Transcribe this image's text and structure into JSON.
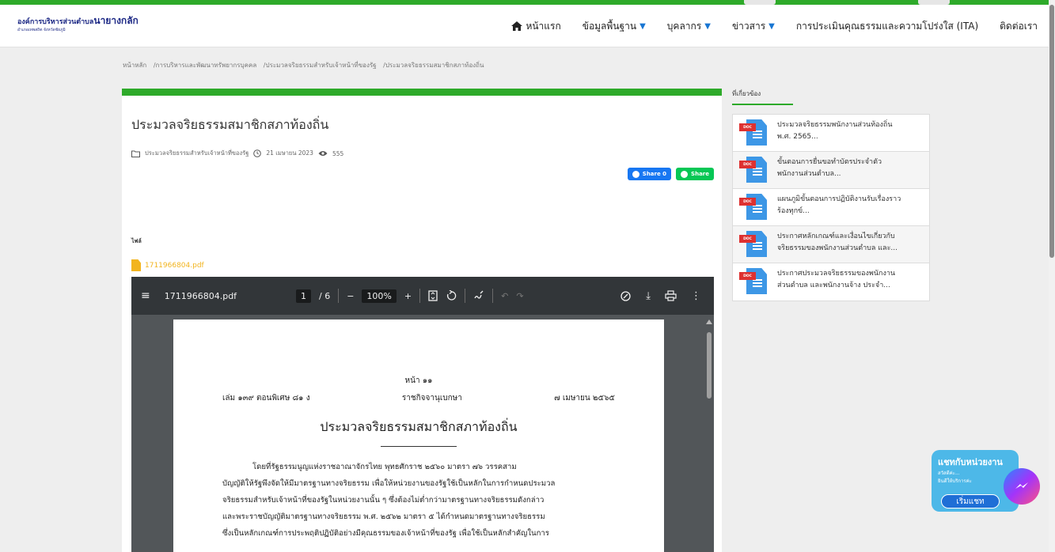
{
  "brand": {
    "line1_prefix": "องค์การบริหารส่วนตำบล",
    "line1_name": "นายางกลัก",
    "line2": "อำเภอเทพสถิต จังหวัดชัยภูมิ"
  },
  "nav": {
    "items": [
      {
        "label": "หน้าแรก",
        "icon": "home-icon"
      },
      {
        "label": "ข้อมูลพื้นฐาน",
        "caret": true
      },
      {
        "label": "บุคลากร",
        "caret": true
      },
      {
        "label": "ข่าวสาร",
        "caret": true
      },
      {
        "label": "การประเมินคุณธรรมและความโปร่งใส (ITA)"
      },
      {
        "label": "ติดต่อเรา"
      }
    ]
  },
  "breadcrumb": [
    "หน้าหลัก",
    "/การบริหารและพัฒนาทรัพยากรบุคคล",
    "/ประมวลจริยธรรมสำหรับเจ้าหน้าที่ของรัฐ",
    "/ประมวลจริยธรรมสมาชิกสภาท้องถิ่น"
  ],
  "article": {
    "title": "ประมวลจริยธรรมสมาชิกสภาท้องถิ่น",
    "category": "ประมวลจริยธรรมสำหรับเจ้าหน้าที่ของรัฐ",
    "date": "21 เมษายน 2023",
    "views": "555",
    "share_fb": "Share 0",
    "share_line": "Share",
    "file_label": "ไฟล์",
    "file_name": "1711966804.pdf"
  },
  "pdf_viewer": {
    "file_name": "1711966804.pdf",
    "current_page": "1",
    "total_pages": "/ 6",
    "zoom": "100%",
    "page": {
      "page_number": "หน้า ๑๑",
      "gazette_left": "เล่ม ๑๓๙  ตอนพิเศษ  ๘๑  ง",
      "gazette_center": "ราชกิจจานุเบกษา",
      "gazette_right": "๗  เมษายน  ๒๕๖๕",
      "title": "ประมวลจริยธรรมสมาชิกสภาท้องถิ่น",
      "body": [
        "โดยที่รัฐธรรมนูญแห่งราชอาณาจักรไทย  พุทธศักราช  ๒๕๖๐  มาตรา  ๗๖  วรรคสาม",
        "บัญญัติให้รัฐพึงจัดให้มีมาตรฐานทางจริยธรรม  เพื่อให้หน่วยงานของรัฐใช้เป็นหลักในการกำหนดประมวล",
        "จริยธรรมสำหรับเจ้าหน้าที่ของรัฐในหน่วยงานนั้น ๆ  ซึ่งต้องไม่ต่ำกว่ามาตรฐานทางจริยธรรมดังกล่าว",
        "และพระราชบัญญัติมาตรฐานทางจริยธรรม  พ.ศ.  ๒๕๖๒  มาตรา  ๕  ได้กำหนดมาตรฐานทางจริยธรรม",
        "ซึ่งเป็นหลักเกณฑ์การประพฤติปฏิบัติอย่างมีคุณธรรมของเจ้าหน้าที่ของรัฐ  เพื่อใช้เป็นหลักสำคัญในการ"
      ]
    }
  },
  "sidebar": {
    "title": "ที่เกี่ยวข้อง",
    "items": [
      {
        "line1": "ประมวลจริยธรรมพนักงานส่วนท้องถิ่น",
        "line2": "พ.ศ. 2565..."
      },
      {
        "line1": "ขั้นตอนการยื่นขอทำบัตรประจำตัว",
        "line2": "พนักงานส่วนตำบล..."
      },
      {
        "line1": "แผนภูมิขั้นตอนการปฏิบัติงานรับเรื่องราว",
        "line2": "ร้องทุกข์..."
      },
      {
        "line1": "ประกาศหลักเกณฑ์และเงื่อนไขเกี่ยวกับ",
        "line2": "จริยธรรมของพนักงานส่วนตำบล และ..."
      },
      {
        "line1": "ประกาศประมวลจริยธรรมของพนักงาน",
        "line2": "ส่วนตำบล และพนักงานจ้าง ประจำ..."
      }
    ],
    "doc_tag": "DOC"
  },
  "chat": {
    "title": "แชทกับหน่วยงาน",
    "greeting1": "สวัสดีค่ะ...",
    "greeting2": "ยินดีให้บริการค่ะ",
    "start": "เริ่มแชท"
  },
  "colors": {
    "accent_green": "#2eaa2a",
    "brand_blue": "#1e2a86",
    "caret_blue": "#1976d2"
  }
}
